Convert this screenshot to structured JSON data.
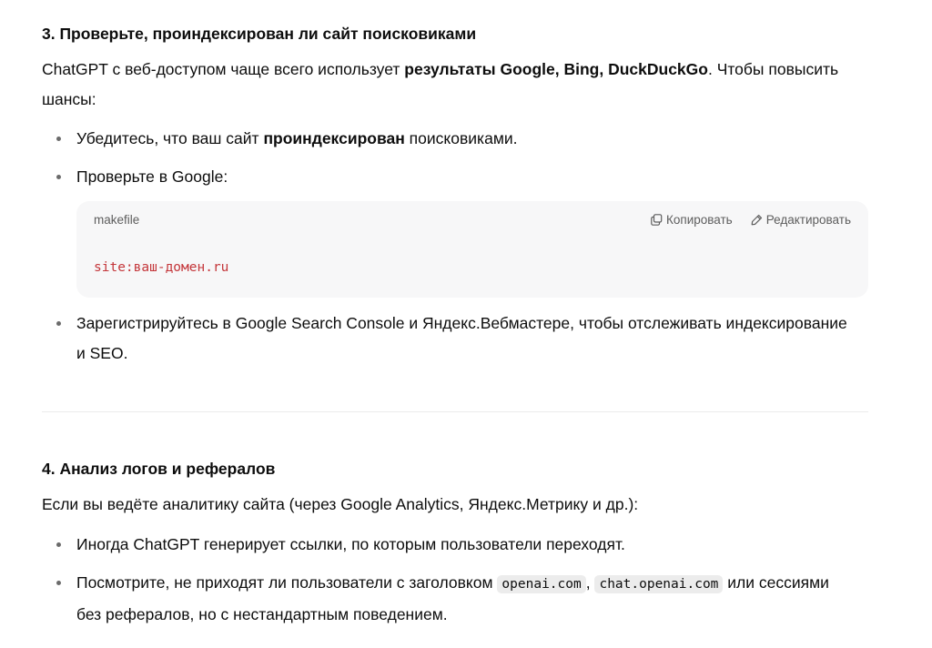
{
  "section3": {
    "heading": "3. Проверьте, проиндексирован ли сайт поисковиками",
    "intro_pre": "ChatGPT с веб-доступом чаще всего использует ",
    "intro_bold": "результаты Google, Bing, DuckDuckGo",
    "intro_post": ". Чтобы повысить шансы:",
    "bullet1_pre": "Убедитесь, что ваш сайт ",
    "bullet1_bold": "проиндексирован",
    "bullet1_post": " поисковиками.",
    "bullet2": "Проверьте в Google:",
    "code": {
      "language": "makefile",
      "copy_label": "Копировать",
      "edit_label": "Редактировать",
      "text": "site:ваш-домен.ru"
    },
    "bullet3": "Зарегистрируйтесь в Google Search Console и Яндекс.Вебмастере, чтобы отслеживать индексирование и SEO."
  },
  "section4": {
    "heading": "4. Анализ логов и рефералов",
    "intro": "Если вы ведёте аналитику сайта (через Google Analytics, Яндекс.Метрику и др.):",
    "bullet1": "Иногда ChatGPT генерирует ссылки, по которым пользователи переходят.",
    "bullet2_pre": "Посмотрите, не приходят ли пользователи с заголовком ",
    "bullet2_code1": "openai.com",
    "bullet2_sep": ", ",
    "bullet2_code2": "chat.openai.com",
    "bullet2_post": " или сессиями без рефералов, но с нестандартным поведением."
  },
  "icons": {
    "copy": "copy-icon",
    "edit": "pencil-icon"
  }
}
